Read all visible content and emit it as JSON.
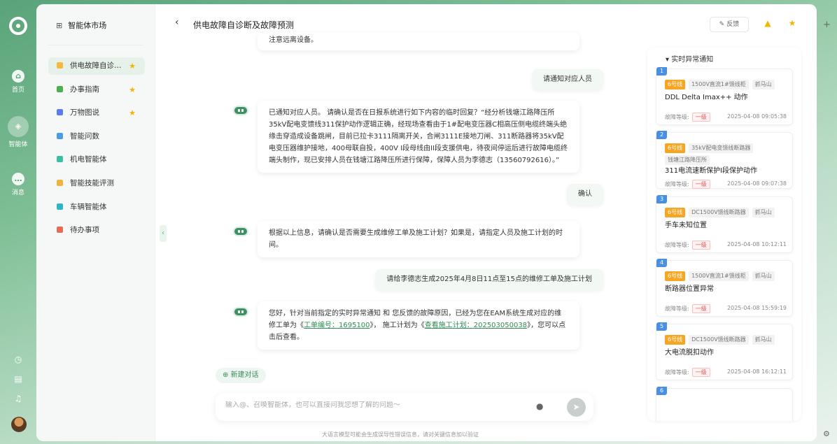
{
  "rail": {
    "home": "首页",
    "agent": "智能体",
    "message": "消息"
  },
  "sidebar": {
    "title": "智能体市场",
    "items": [
      {
        "label": "供电故障自诊…",
        "color": "#f5b942",
        "star": "★"
      },
      {
        "label": "办事指南",
        "color": "#4caf50",
        "star": "★"
      },
      {
        "label": "万物图说",
        "color": "#5b7cf0",
        "star": "★"
      },
      {
        "label": "智能问数",
        "color": "#4a9be8",
        "star": ""
      },
      {
        "label": "机电智能体",
        "color": "#3bbfa0",
        "star": ""
      },
      {
        "label": "智能技能评测",
        "color": "#f0b43c",
        "star": ""
      },
      {
        "label": "车辆智能体",
        "color": "#2fb5c8",
        "star": ""
      },
      {
        "label": "待办事项",
        "color": "#e86a5a",
        "star": ""
      }
    ]
  },
  "header": {
    "title": "供电故障自诊断及故障预测",
    "feedback": "反馈"
  },
  "chat": {
    "m0": "注意远离设备。",
    "u1": "请通知对应人员",
    "b2": "已通知对应人员。 请确认是否在日报系统进行如下内容的临时回复？“经分析钱塘江路降压所35kV配电变馈线311保护动作逻辑正确，经现场查看由于1#配电变压器C相高压侧电缆终端头绝缘击穿造成设备跳闸，目前已拉卡3111隔离开关，合闸3111E接地刀闸、311断路器将35kV配电变压器维护接地，400母联自投，400V I段母线由II段支援供电，待夜间停运后进行故障电缆终端头制作，现已安排人员在钱塘江路降压所进行保障，保障人员为李德志（13560792616）。”",
    "u3": "确认",
    "b4": "根据以上信息，请确认是否需要生成维修工单及施工计划？如果是，请指定人员及施工计划的时间。",
    "u5": "请给李德志生成2025年4月8日11点至15点的维修工单及施工计划",
    "b6_a": "您好，针对当前指定的实时异常通知 和 您反馈的故障原因，已经为您在EAM系统生成对应的维修工单为《",
    "b6_link1": "工单编号：1695100",
    "b6_b": "》， 施工计划为《",
    "b6_link2": "查看施工计划：202503050038",
    "b6_c": "》，您可以点击后查看。"
  },
  "new_chat": "新建对话",
  "input": {
    "placeholder": "输入@、召唤智能体，也可以直接问我您想了解的问题～"
  },
  "disclaimer": "大语言模型可能会生成误导性错误信息，请对关键信息加以验证",
  "notice": {
    "title": "实时异常通知",
    "level_label": "故障等级:",
    "cards": [
      {
        "num": "1",
        "tags": [
          "6号线",
          "1500V直流1#馈线柜",
          "抓马山"
        ],
        "name": "DDL Delta Imax++ 动作",
        "level": "一级",
        "time": "2025-04-08 09:05:38"
      },
      {
        "num": "2",
        "tags": [
          "6号线",
          "35kV配电变馈线断路器",
          "钱塘江路降压所"
        ],
        "name": "311电流速断保护I段保护动作",
        "level": "一级",
        "time": "2025-04-08 09:07:38"
      },
      {
        "num": "3",
        "tags": [
          "6号线",
          "DC1500V馈线断路器",
          "抓马山"
        ],
        "name": "手车未知位置",
        "level": "一级",
        "time": "2025-04-08 10:12:11"
      },
      {
        "num": "4",
        "tags": [
          "6号线",
          "1500V直流1#馈线柜",
          "抓马山"
        ],
        "name": "断路器位置异常",
        "level": "一级",
        "time": "2025-04-08 15:59:19"
      },
      {
        "num": "5",
        "tags": [
          "6号线",
          "DC1500V馈线断路器",
          "抓马山"
        ],
        "name": "大电流脱扣动作",
        "level": "一级",
        "time": "2025-04-08 16:12:11"
      },
      {
        "num": "6",
        "tags": [],
        "name": "",
        "level": "",
        "time": ""
      }
    ]
  }
}
